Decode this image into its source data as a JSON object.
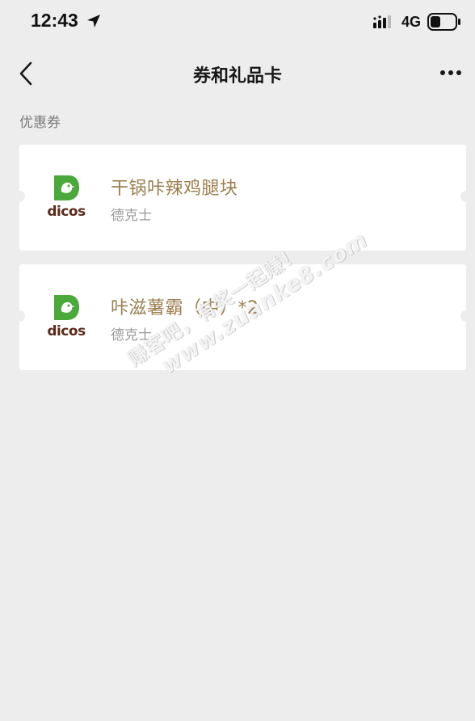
{
  "status_bar": {
    "time": "12:43",
    "network": "4G",
    "icons": [
      "location-arrow-icon",
      "signal-icon",
      "battery-icon"
    ]
  },
  "nav": {
    "title": "券和礼品卡",
    "back_icon": "chevron-left-icon",
    "more_icon": "ellipsis-icon"
  },
  "section_label": "优惠券",
  "coupons": [
    {
      "title": "干锅咔辣鸡腿块",
      "merchant": "德克士",
      "logo_text": "dicos"
    },
    {
      "title": "咔滋薯霸（中）*2",
      "merchant": "德克士",
      "logo_text": "dicos"
    }
  ],
  "watermark": {
    "line1": "赚客吧，有奖一起赚！",
    "line2": "www.zuanke8.com"
  },
  "colors": {
    "background": "#ededed",
    "coupon_title": "#9b7f4e",
    "logo_green": "#4aa93a",
    "logo_brown": "#5a2a1a"
  }
}
